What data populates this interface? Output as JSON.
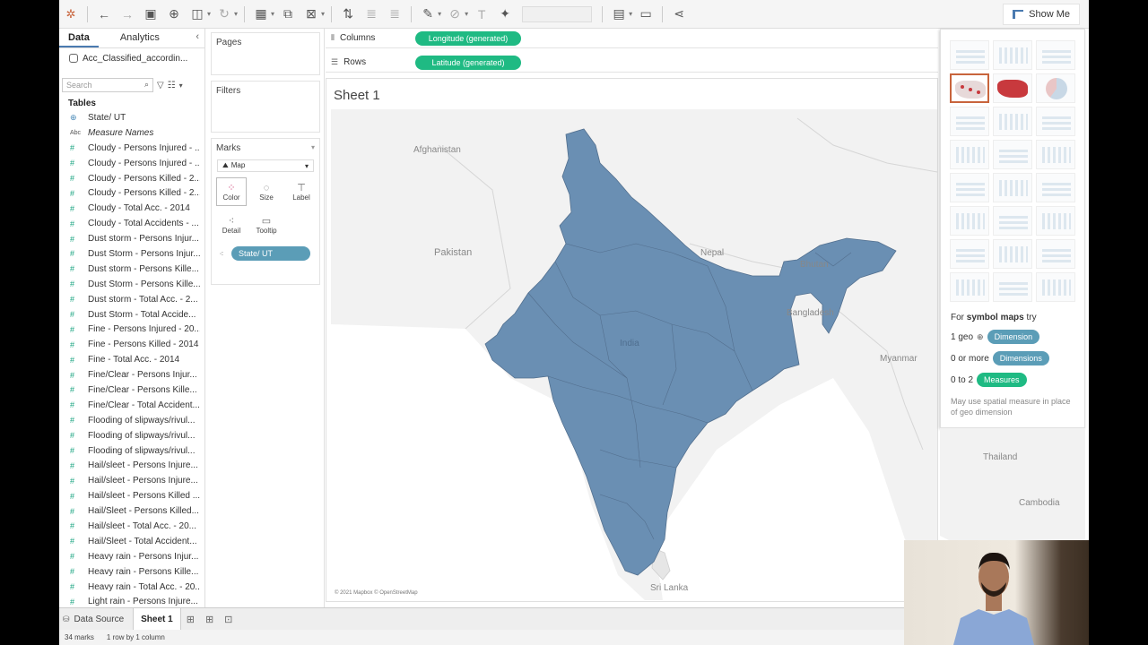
{
  "toolbar": {
    "icons": [
      "tableau-logo-icon",
      "undo-icon",
      "redo-icon",
      "save-icon",
      "new-datasource-icon",
      "pause-updates-icon",
      "refresh-icon",
      "new-sheet-icon",
      "duplicate-sheet-icon",
      "clear-sheet-icon",
      "swap-icon",
      "sort-asc-icon",
      "sort-desc-icon",
      "highlight-icon",
      "group-icon",
      "label-icon",
      "pin-icon",
      "fit-dropdown",
      "show-cards-icon",
      "presentation-icon",
      "share-icon"
    ],
    "show_me_label": "Show Me"
  },
  "data_pane": {
    "tabs": [
      "Data",
      "Analytics"
    ],
    "datasource": "Acc_Classified_accordin...",
    "search_placeholder": "Search",
    "tables_label": "Tables",
    "fields": [
      {
        "label": "State/ UT",
        "type": "geo"
      },
      {
        "label": "Measure Names",
        "type": "abc"
      },
      {
        "label": "Cloudy - Persons Injured - ...",
        "type": "measure"
      },
      {
        "label": "Cloudy - Persons Injured - ...",
        "type": "measure"
      },
      {
        "label": "Cloudy - Persons Killed - 2...",
        "type": "measure"
      },
      {
        "label": "Cloudy - Persons Killed - 2...",
        "type": "measure"
      },
      {
        "label": "Cloudy - Total Acc. - 2014",
        "type": "measure"
      },
      {
        "label": "Cloudy - Total Accidents - ...",
        "type": "measure"
      },
      {
        "label": "Dust storm - Persons Injur...",
        "type": "measure"
      },
      {
        "label": "Dust Storm - Persons Injur...",
        "type": "measure"
      },
      {
        "label": "Dust storm - Persons Kille...",
        "type": "measure"
      },
      {
        "label": "Dust Storm - Persons Kille...",
        "type": "measure"
      },
      {
        "label": "Dust storm - Total Acc. - 2...",
        "type": "measure"
      },
      {
        "label": "Dust Storm - Total Accide...",
        "type": "measure"
      },
      {
        "label": "Fine - Persons Injured - 20...",
        "type": "measure"
      },
      {
        "label": "Fine - Persons Killed - 2014",
        "type": "measure"
      },
      {
        "label": "Fine - Total Acc. - 2014",
        "type": "measure"
      },
      {
        "label": "Fine/Clear - Persons Injur...",
        "type": "measure"
      },
      {
        "label": "Fine/Clear - Persons Kille...",
        "type": "measure"
      },
      {
        "label": "Fine/Clear - Total Accident...",
        "type": "measure"
      },
      {
        "label": "Flooding of slipways/rivul...",
        "type": "measure"
      },
      {
        "label": "Flooding of slipways/rivul...",
        "type": "measure"
      },
      {
        "label": "Flooding of slipways/rivul...",
        "type": "measure"
      },
      {
        "label": "Hail/sleet - Persons Injure...",
        "type": "measure"
      },
      {
        "label": "Hail/sleet - Persons Injure...",
        "type": "measure"
      },
      {
        "label": "Hail/sleet - Persons Killed ...",
        "type": "measure"
      },
      {
        "label": "Hail/Sleet - Persons Killed...",
        "type": "measure"
      },
      {
        "label": "Hail/sleet - Total Acc. - 20...",
        "type": "measure"
      },
      {
        "label": "Hail/Sleet - Total Accident...",
        "type": "measure"
      },
      {
        "label": "Heavy rain - Persons Injur...",
        "type": "measure"
      },
      {
        "label": "Heavy rain - Persons Kille...",
        "type": "measure"
      },
      {
        "label": "Heavy rain - Total Acc. - 20...",
        "type": "measure"
      },
      {
        "label": "Light rain - Persons Injure...",
        "type": "measure"
      }
    ]
  },
  "shelves": {
    "pages_label": "Pages",
    "filters_label": "Filters",
    "marks_label": "Marks",
    "mark_type": "Map",
    "mark_buttons": [
      "Color",
      "Size",
      "Label",
      "Detail",
      "Tooltip"
    ],
    "detail_pill": "State/ UT",
    "columns_label": "Columns",
    "rows_label": "Rows",
    "columns_pill": "Longitude (generated)",
    "rows_pill": "Latitude (generated)"
  },
  "worksheet": {
    "title": "Sheet 1",
    "map_labels": {
      "afghanistan": "Afghanistan",
      "pakistan": "Pakistan",
      "nepal": "Nepal",
      "bhutan": "Bhutan",
      "bangladesh": "Bangladesh",
      "india": "India",
      "myanmar": "Myanmar",
      "thailand": "Thailand",
      "cambodia": "Cambodia",
      "sri_lanka": "Sri Lanka"
    },
    "credit": "© 2021 Mapbox © OpenStreetMap",
    "fill_color": "#6a8fb3"
  },
  "show_me": {
    "hint_prefix": "For ",
    "hint_bold": "symbol maps",
    "hint_suffix": " try",
    "rows": [
      {
        "label": "1 geo",
        "pill": "Dimension",
        "kind": "dim"
      },
      {
        "label": "0 or more",
        "pill": "Dimensions",
        "kind": "dim"
      },
      {
        "label": "0 to 2",
        "pill": "Measures",
        "kind": "meas"
      }
    ],
    "note": "May use spatial measure in place of geo dimension"
  },
  "tabs": {
    "data_source": "Data Source",
    "sheet": "Sheet 1"
  },
  "status": {
    "marks": "34 marks",
    "rows_cols": "1 row by 1 column"
  }
}
